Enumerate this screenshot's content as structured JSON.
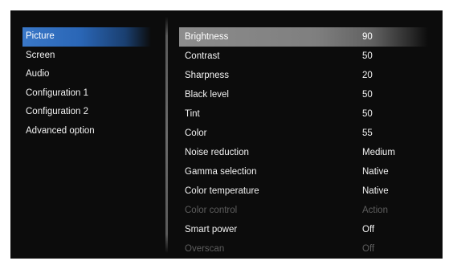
{
  "left_menu": {
    "items": [
      {
        "label": "Picture",
        "active": true
      },
      {
        "label": "Screen"
      },
      {
        "label": "Audio"
      },
      {
        "label": "Configuration 1"
      },
      {
        "label": "Configuration 2"
      },
      {
        "label": "Advanced option"
      }
    ]
  },
  "picture_settings": {
    "rows": [
      {
        "label": "Brightness",
        "value": "90",
        "active": true
      },
      {
        "label": "Contrast",
        "value": "50"
      },
      {
        "label": "Sharpness",
        "value": "20"
      },
      {
        "label": "Black level",
        "value": "50"
      },
      {
        "label": "Tint",
        "value": "50"
      },
      {
        "label": "Color",
        "value": "55"
      },
      {
        "label": "Noise reduction",
        "value": "Medium"
      },
      {
        "label": "Gamma selection",
        "value": "Native"
      },
      {
        "label": "Color temperature",
        "value": "Native"
      },
      {
        "label": "Color control",
        "value": "Action",
        "disabled": true
      },
      {
        "label": "Smart power",
        "value": "Off"
      },
      {
        "label": "Overscan",
        "value": "Off",
        "disabled": true
      }
    ]
  },
  "colors": {
    "background": "#0c0c0c",
    "left_highlight": "#2a66b6",
    "right_highlight": "#7f7f7f",
    "text": "#f2f2f2",
    "disabled_text": "#5e5e5e"
  }
}
